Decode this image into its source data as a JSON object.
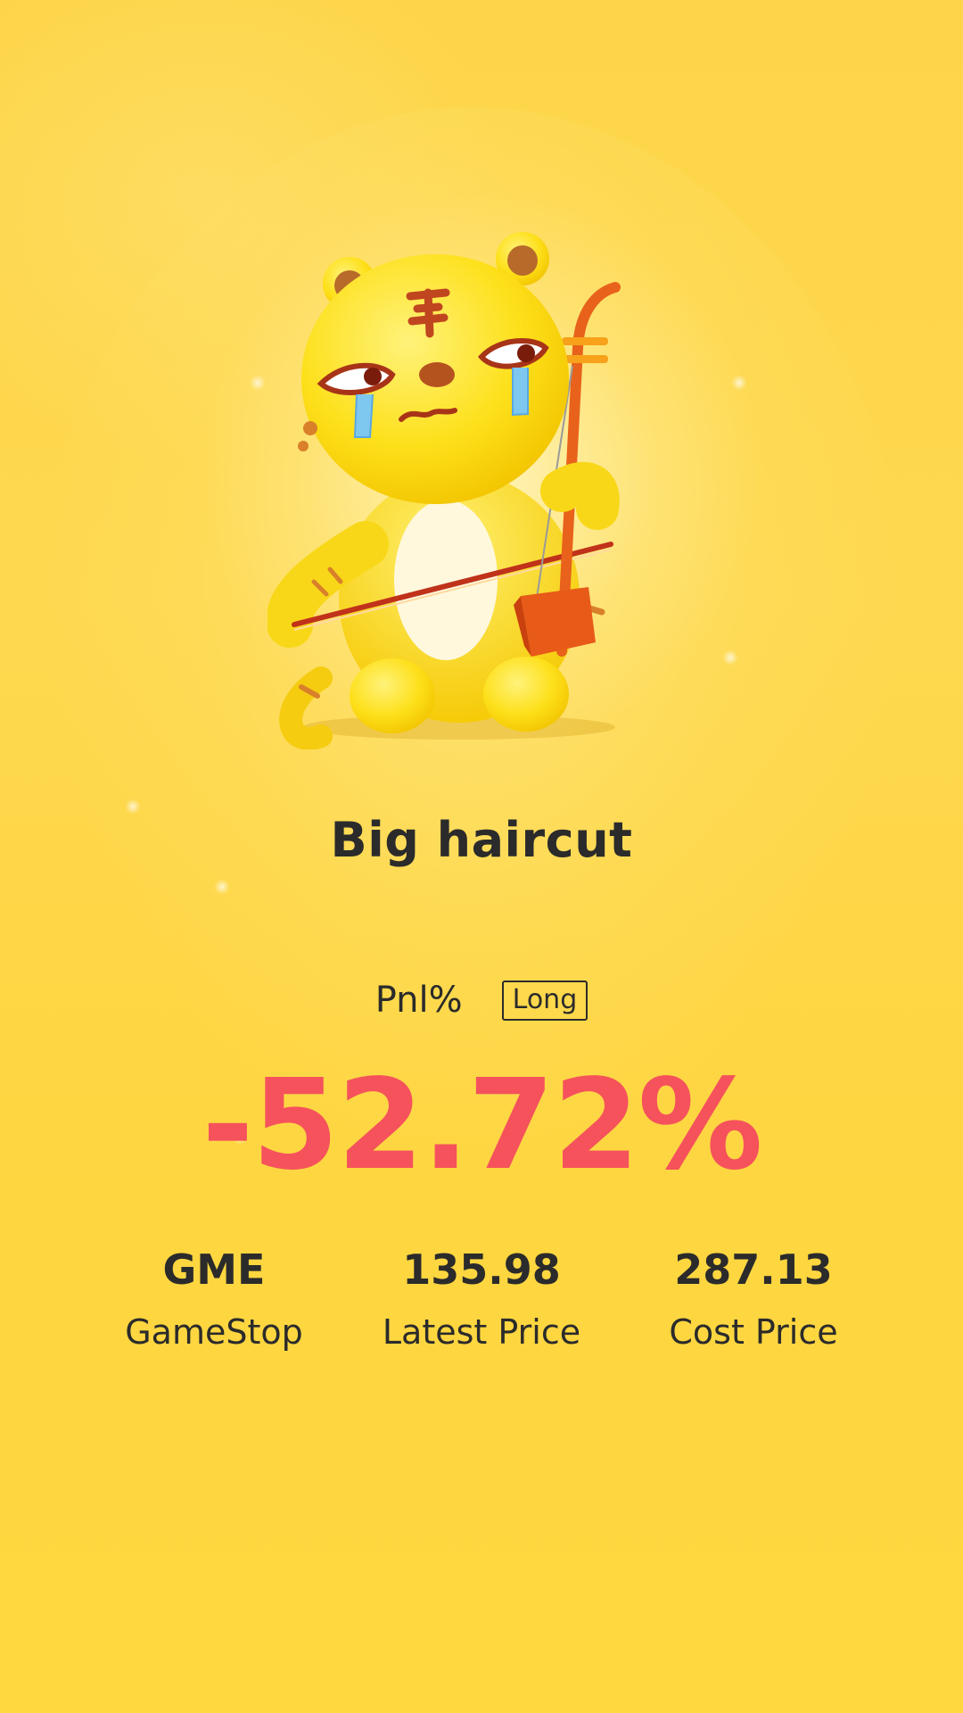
{
  "title": "Big haircut",
  "pnl": {
    "label": "Pnl%",
    "position_badge": "Long",
    "value": "-52.72%"
  },
  "stats": [
    {
      "value": "GME",
      "label": "GameStop"
    },
    {
      "value": "135.98",
      "label": "Latest Price"
    },
    {
      "value": "287.13",
      "label": "Cost Price"
    }
  ],
  "mascot": {
    "icon": "crying-tiger-erhu-icon"
  },
  "colors": {
    "background": "#fed640",
    "loss": "#f5525c",
    "text": "#2b2b2b"
  }
}
